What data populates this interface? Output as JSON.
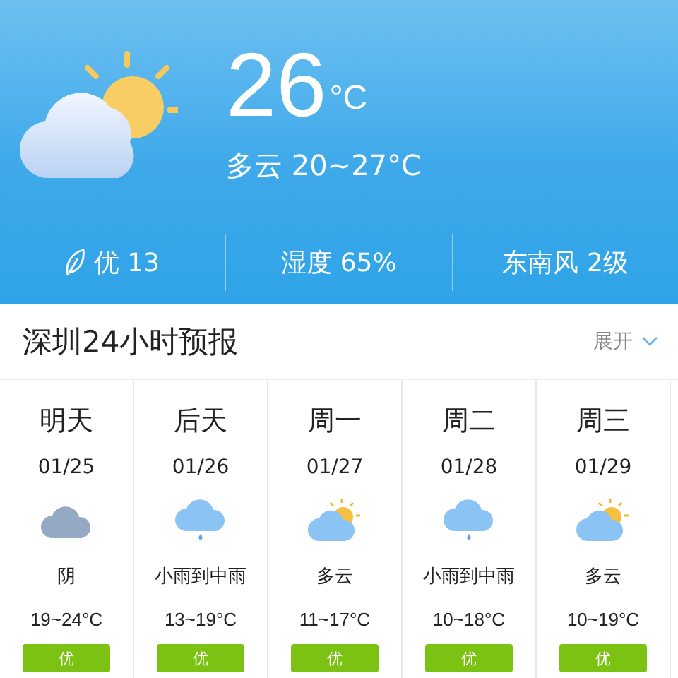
{
  "current": {
    "kind": "partly-cloudy",
    "temperature": "26",
    "unit": "°C",
    "summary": "多云 20~27°C"
  },
  "stats": [
    {
      "kind": "air",
      "text": "优 13"
    },
    {
      "kind": "plain",
      "text": "湿度 65%"
    },
    {
      "kind": "plain",
      "text": "东南风 2级"
    }
  ],
  "forecast_header": {
    "title": "深圳24小时预报",
    "expand": "展开"
  },
  "days": [
    {
      "day": "明天",
      "date": "01/25",
      "kind": "overcast",
      "condition": "阴",
      "range": "19~24°C",
      "air": "优"
    },
    {
      "day": "后天",
      "date": "01/26",
      "kind": "rain",
      "condition": "小雨到中雨",
      "range": "13~19°C",
      "air": "优"
    },
    {
      "day": "周一",
      "date": "01/27",
      "kind": "partly-cloudy",
      "condition": "多云",
      "range": "11~17°C",
      "air": "优"
    },
    {
      "day": "周二",
      "date": "01/28",
      "kind": "rain",
      "condition": "小雨到中雨",
      "range": "10~18°C",
      "air": "优"
    },
    {
      "day": "周三",
      "date": "01/29",
      "kind": "partly-cloudy",
      "condition": "多云",
      "range": "10~19°C",
      "air": "优"
    }
  ]
}
